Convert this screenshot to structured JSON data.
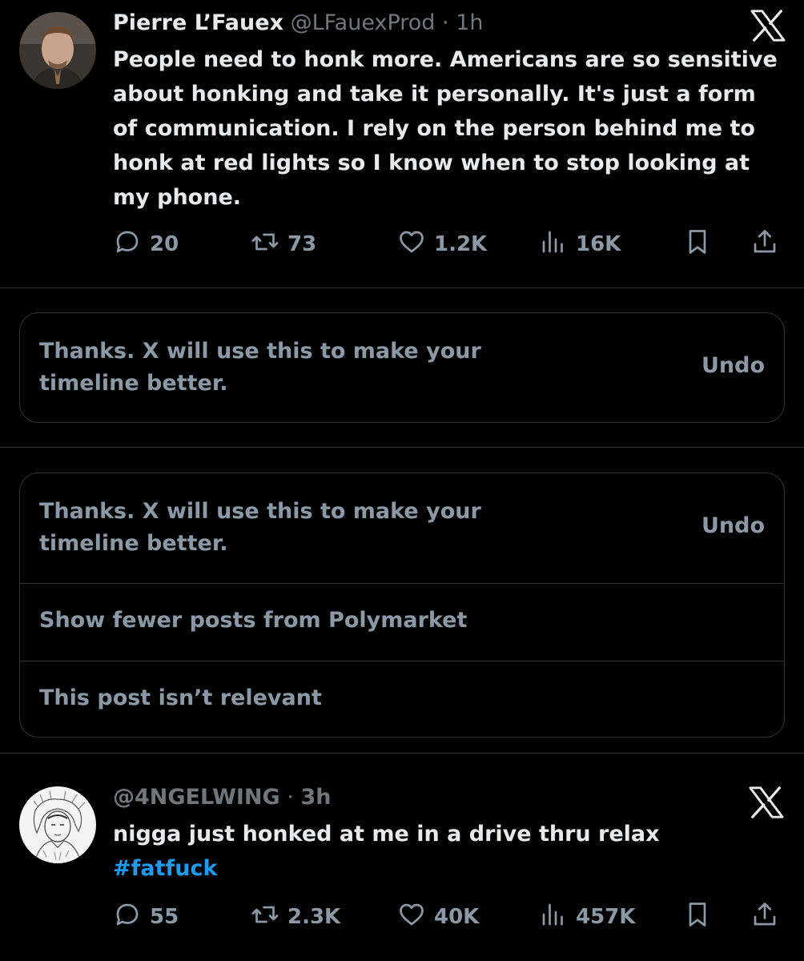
{
  "post1": {
    "author_name": "Pierre L’Fauex",
    "handle": "@LFauexProd",
    "separator": "·",
    "time": "1h",
    "text": "People need to honk more. Americans are so sensitive about honking and take it personally. It's just a form of communication. I rely on the person behind me to honk at red lights so I know when to stop looking at my phone.",
    "replies": "20",
    "reposts": "73",
    "likes": "1.2K",
    "views": "16K"
  },
  "feedback1": {
    "message": "Thanks. X will use this to make your timeline better.",
    "undo": "Undo"
  },
  "feedback2": {
    "message": "Thanks. X will use this to make your timeline better.",
    "undo": "Undo",
    "option_fewer": "Show fewer posts from Polymarket",
    "option_irrelevant": "This post isn’t relevant"
  },
  "post2": {
    "handle": "@4NGELWING",
    "separator": "·",
    "time": "3h",
    "text": "nigga just honked at me in a drive thru relax",
    "hashtag": "#fatfuck",
    "replies": "55",
    "reposts": "2.3K",
    "likes": "40K",
    "views": "457K"
  },
  "icons": {
    "reply": "reply-icon",
    "repost": "repost-icon",
    "like": "heart-icon",
    "views": "views-icon",
    "bookmark": "bookmark-icon",
    "share": "share-icon",
    "close": "x-logo-icon"
  },
  "colors": {
    "background": "#000000",
    "text": "#e7e9ea",
    "muted": "#71767b",
    "action": "#8b98a5",
    "link": "#1d9bf0",
    "border": "#2f3336"
  }
}
